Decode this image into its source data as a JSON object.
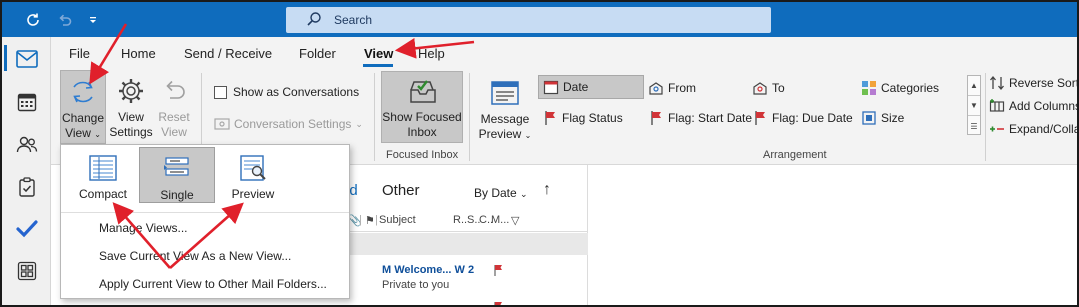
{
  "titlebar": {
    "search_placeholder": "Search",
    "icons": [
      "sync-icon",
      "undo-icon",
      "customize-toolbar-icon"
    ]
  },
  "leftbar": {
    "icons": [
      "mail-icon",
      "calendar-icon",
      "people-icon",
      "tasks-icon",
      "todo-icon",
      "apps-icon"
    ]
  },
  "ribbon": {
    "tabs": [
      "File",
      "Home",
      "Send / Receive",
      "Folder",
      "View",
      "Help"
    ],
    "active_tab": "View",
    "current_view": {
      "change_view_line1": "Change",
      "change_view_line2": "View",
      "view_settings_line1": "View",
      "view_settings_line2": "Settings",
      "reset_view_line1": "Reset",
      "reset_view_line2": "View"
    },
    "messages": {
      "show_as_conversations": "Show as Conversations",
      "conversation_settings": "Conversation Settings"
    },
    "focused_inbox": {
      "button_line1": "Show Focused",
      "button_line2": "Inbox",
      "group_label": "Focused Inbox"
    },
    "arrangement": {
      "message_preview_line1": "Message",
      "message_preview_line2": "Preview",
      "items": [
        "Date",
        "From",
        "To",
        "Categories",
        "Flag Status",
        "Flag: Start Date",
        "Flag: Due Date",
        "Size"
      ],
      "selected": "Date",
      "group_label": "Arrangement"
    },
    "sort": {
      "reverse_sort": "Reverse Sort",
      "add_columns": "Add Columns",
      "expand_collapse": "Expand/Colla"
    }
  },
  "dropdown": {
    "views": [
      {
        "label": "Compact",
        "icon": "compact-view-icon"
      },
      {
        "label": "Single",
        "icon": "single-view-icon"
      },
      {
        "label": "Preview",
        "icon": "preview-view-icon"
      }
    ],
    "selected_view": "Single",
    "menu": {
      "manage_views": "Manage Views...",
      "save_view": "Save Current View As a New View...",
      "apply_view": "Apply Current View to Other Mail Folders..."
    }
  },
  "message_list": {
    "tab_focused_partial": "ed",
    "tab_other": "Other",
    "sort_by": "By Date",
    "columns": {
      "subject": "Subject",
      "r": "R..",
      "s": "S..",
      "c": "C..",
      "m": "M..."
    },
    "message": {
      "sender": "M Welcome... W 2",
      "preview": "Private to you"
    }
  },
  "colors": {
    "accent": "#0f6cbd",
    "annotation_arrow": "#e0202b",
    "flag": "#d13438"
  }
}
